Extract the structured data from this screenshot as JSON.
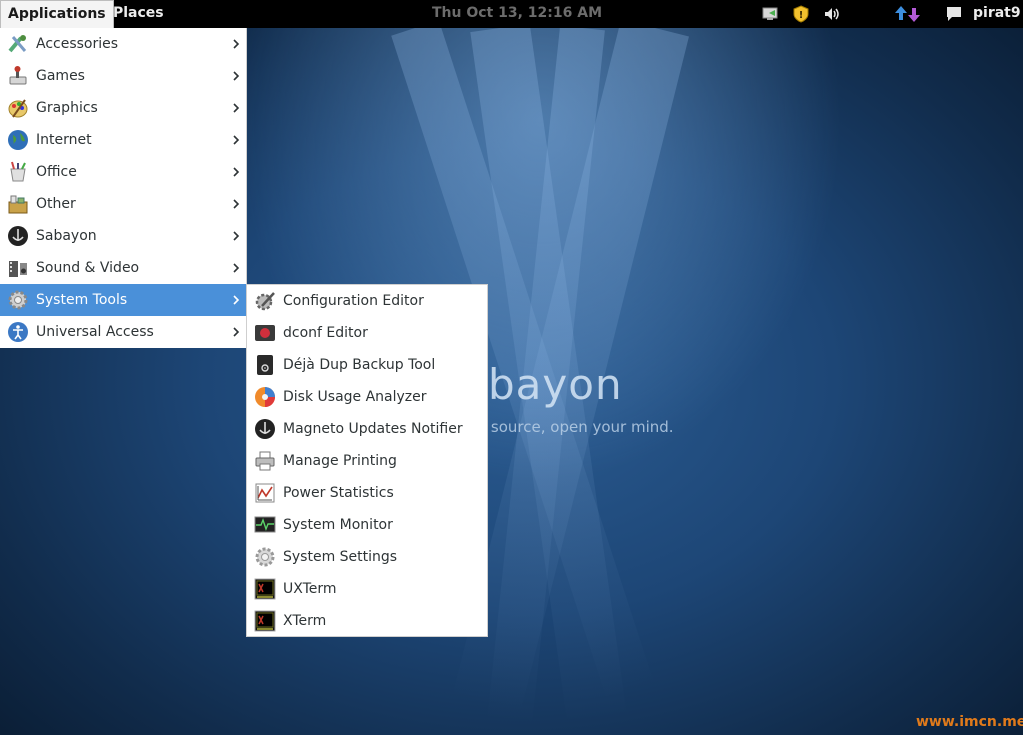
{
  "top_bar": {
    "applications_label": "Applications",
    "places_label": "Places",
    "clock": "Thu Oct 13, 12:16 AM",
    "tray_icons": [
      "display-icon",
      "shield-icon",
      "volume-icon",
      "network-arrows-icon",
      "chat-icon"
    ],
    "user_name": "pirat9"
  },
  "main_menu": {
    "items": [
      {
        "label": "Accessories",
        "icon": "accessories-icon"
      },
      {
        "label": "Games",
        "icon": "games-icon"
      },
      {
        "label": "Graphics",
        "icon": "graphics-icon"
      },
      {
        "label": "Internet",
        "icon": "globe-icon"
      },
      {
        "label": "Office",
        "icon": "office-icon"
      },
      {
        "label": "Other",
        "icon": "other-icon"
      },
      {
        "label": "Sabayon",
        "icon": "sabayon-icon"
      },
      {
        "label": "Sound & Video",
        "icon": "sound-video-icon"
      },
      {
        "label": "System Tools",
        "icon": "system-tools-icon",
        "active": true
      },
      {
        "label": "Universal Access",
        "icon": "universal-access-icon"
      }
    ]
  },
  "sub_menu": {
    "items": [
      {
        "label": "Configuration Editor",
        "icon": "configuration-editor-icon"
      },
      {
        "label": "dconf Editor",
        "icon": "dconf-editor-icon"
      },
      {
        "label": "Déjà Dup Backup Tool",
        "icon": "backup-icon"
      },
      {
        "label": "Disk Usage Analyzer",
        "icon": "disk-usage-icon"
      },
      {
        "label": "Magneto Updates Notifier",
        "icon": "magneto-icon"
      },
      {
        "label": "Manage Printing",
        "icon": "printer-icon"
      },
      {
        "label": "Power Statistics",
        "icon": "power-statistics-icon"
      },
      {
        "label": "System Monitor",
        "icon": "system-monitor-icon"
      },
      {
        "label": "System Settings",
        "icon": "system-settings-icon"
      },
      {
        "label": "UXTerm",
        "icon": "uxterm-icon"
      },
      {
        "label": "XTerm",
        "icon": "xterm-icon"
      }
    ]
  },
  "wallpaper": {
    "brand_text": "bayon",
    "tagline": "r source, open your mind."
  },
  "watermark": "www.imcn.me",
  "colors": {
    "highlight": "#4a90d9",
    "top_bar": "#000000",
    "watermark": "#e07a1b"
  }
}
